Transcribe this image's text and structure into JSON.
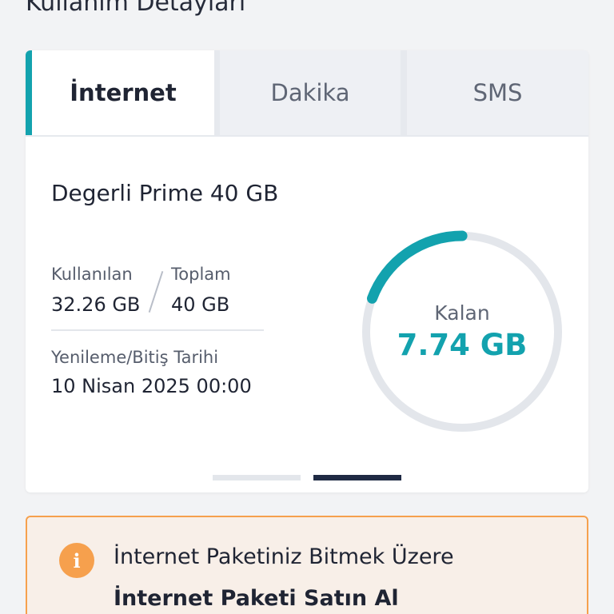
{
  "header": {
    "title": "Kullanım Detayları"
  },
  "tabs": [
    {
      "label": "İnternet",
      "active": true
    },
    {
      "label": "Dakika",
      "active": false
    },
    {
      "label": "SMS",
      "active": false
    }
  ],
  "usage": {
    "plan_name": "Degerli Prime 40 GB",
    "used_label": "Kullanılan",
    "used_value": "32.26 GB",
    "total_label": "Toplam",
    "total_value": "40 GB",
    "renewal_label": "Yenileme/Bitiş Tarihi",
    "renewal_value": "10 Nisan 2025 00:00",
    "remaining_label": "Kalan",
    "remaining_value": "7.74 GB",
    "remaining_fraction": 0.1935
  },
  "pager": {
    "count": 2,
    "active_index": 1
  },
  "warning": {
    "icon": "info-icon",
    "icon_glyph": "i",
    "message": "İnternet Paketiniz Bitmek Üzere",
    "link_label": "İnternet Paketi Satın Al"
  },
  "colors": {
    "accent": "#13a2ae",
    "ring_track": "#e3e6eb",
    "warning_border": "#f6a04d",
    "warning_bg": "#f8efe8",
    "pager_active": "#1f2a44"
  }
}
